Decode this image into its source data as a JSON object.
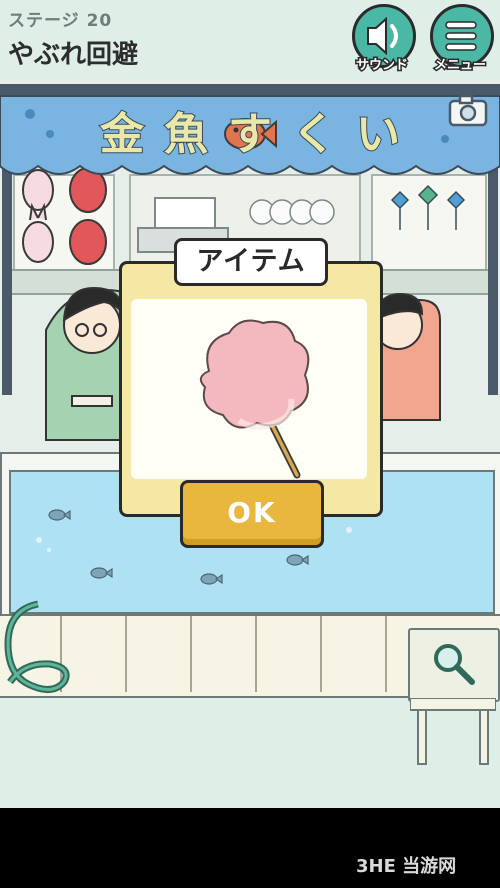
{
  "hud": {
    "stage_label": "ステージ 20",
    "stage_title": "やぶれ回避",
    "sound_label": "サウンド",
    "menu_label": "メニュー",
    "sound_icon": "speaker-icon",
    "menu_icon": "hamburger-menu-icon",
    "camera_icon": "camera-icon"
  },
  "scene": {
    "sign_text": "金魚すくい",
    "sign_fish_icon": "goldfish-icon",
    "magnifier_icon": "magnifier-icon"
  },
  "dialog": {
    "title": "アイテム",
    "item_icon": "cotton-candy-icon",
    "ok_label": "OK"
  },
  "watermark": "3HE 当游网",
  "colors": {
    "hud_button": "#4ab8a4",
    "dialog_bg": "#f5e7a4",
    "ok_button": "#e9b73d",
    "water": "#aee2f2",
    "awning": "#7ab4e0",
    "sign_text": "#e8e9a8"
  }
}
